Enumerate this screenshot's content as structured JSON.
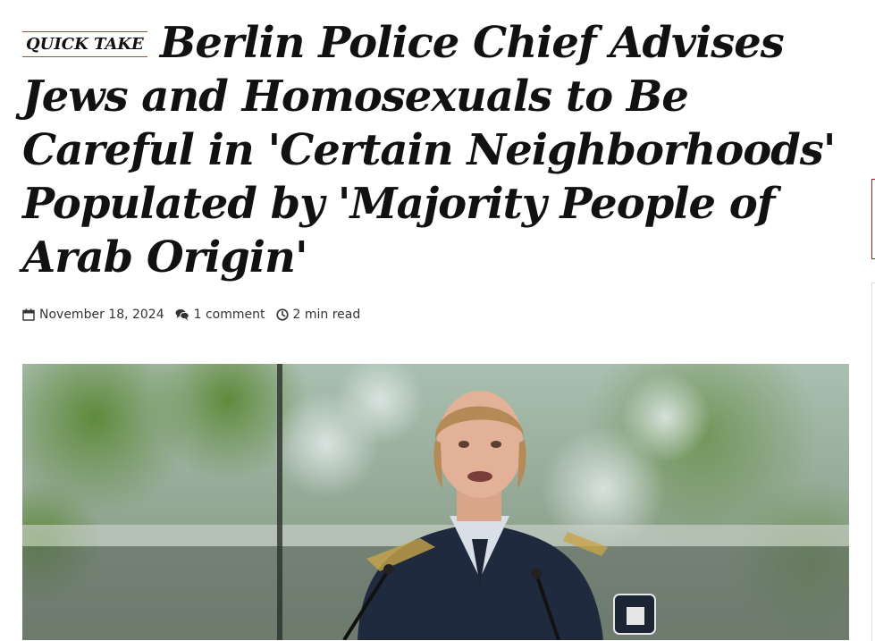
{
  "article": {
    "tag": "QUICK TAKE",
    "title": "Berlin Police Chief Advises Jews and Homosexuals to Be Careful in 'Certain Neighborhoods' Populated by 'Majority People of Arab Origin'",
    "meta": {
      "date": "November 18, 2024",
      "comments": "1 comment",
      "read_time": "2 min read"
    },
    "image_icon": "photo"
  },
  "icons": {
    "date": "calendar-icon",
    "comments": "comments-icon",
    "read_time": "clock-icon"
  },
  "colors": {
    "tag_rule": "#b0463a",
    "sidebar_accent": "#9b1c1c",
    "text": "#111111"
  }
}
